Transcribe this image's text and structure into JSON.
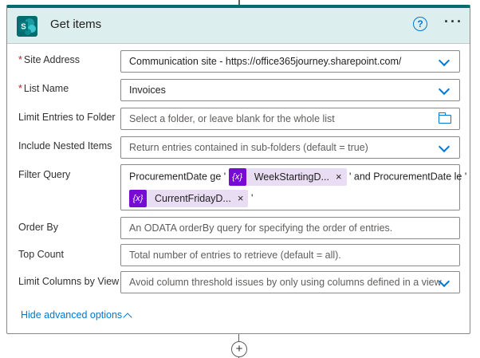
{
  "header": {
    "title": "Get items",
    "help_glyph": "?",
    "more_glyph": "···"
  },
  "fields": {
    "site_address": {
      "label": "Site Address",
      "required_mark": "*",
      "value": "Communication site - https://office365journey.sharepoint.com/"
    },
    "list_name": {
      "label": "List Name",
      "required_mark": "*",
      "value": "Invoices"
    },
    "limit_folder": {
      "label": "Limit Entries to Folder",
      "placeholder": "Select a folder, or leave blank for the whole list"
    },
    "nested_items": {
      "label": "Include Nested Items",
      "placeholder": "Return entries contained in sub-folders (default = true)"
    },
    "filter_query": {
      "label": "Filter Query",
      "text1": "ProcurementDate ge '",
      "token1": "WeekStartingD...",
      "text2": "' and ProcurementDate le '",
      "token2": "CurrentFridayD...",
      "text3": "'",
      "token_glyph": "{x}",
      "remove_glyph": "×"
    },
    "order_by": {
      "label": "Order By",
      "placeholder": "An ODATA orderBy query for specifying the order of entries."
    },
    "top_count": {
      "label": "Top Count",
      "placeholder": "Total number of entries to retrieve (default = all)."
    },
    "limit_columns": {
      "label": "Limit Columns by View",
      "placeholder": "Avoid column threshold issues by only using columns defined in a view"
    }
  },
  "advanced_toggle": "Hide advanced options",
  "add_step_glyph": "+",
  "colors": {
    "accent": "#036c70",
    "link": "#0078d4",
    "token_bg": "#e9ddf3",
    "token_icon": "#770bd6",
    "required": "#a4262c"
  },
  "icons": {
    "logo": "sharepoint-logo",
    "help": "help-circle-icon",
    "more": "more-ellipsis-icon",
    "dropdown": "chevron-down-icon",
    "folder": "folder-icon",
    "expression": "expression-icon",
    "remove": "close-icon",
    "collapse": "chevron-up-icon",
    "add": "plus-icon"
  }
}
